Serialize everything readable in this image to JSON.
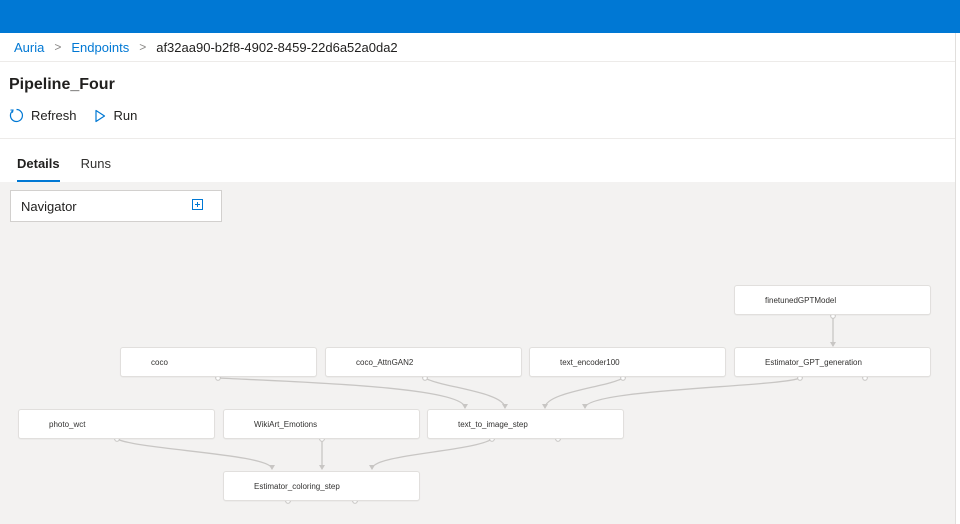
{
  "breadcrumb": {
    "items": [
      "Auria",
      "Endpoints"
    ],
    "current": "af32aa90-b2f8-4902-8459-22d6a52a0da2"
  },
  "page": {
    "title": "Pipeline_Four"
  },
  "toolbar": {
    "refresh_label": "Refresh",
    "run_label": "Run"
  },
  "tabs": [
    "Details",
    "Runs"
  ],
  "active_tab": "Details",
  "navigator": {
    "label": "Navigator",
    "icon": "expand-icon"
  },
  "colors": {
    "accent": "#0078d4",
    "canvas": "#f3f2f1"
  },
  "pipeline": {
    "nodes": {
      "finetunedGPTModel": "finetunedGPTModel",
      "coco": "coco",
      "coco_AttnGAN2": "coco_AttnGAN2",
      "text_encoder100": "text_encoder100",
      "Estimator_GPT_generation": "Estimator_GPT_generation",
      "photo_wct": "photo_wct",
      "WikiArt_Emotions": "WikiArt_Emotions",
      "text_to_image_step": "text_to_image_step",
      "Estimator_coloring_step": "Estimator_coloring_step"
    },
    "edges": [
      [
        "finetunedGPTModel",
        "Estimator_GPT_generation"
      ],
      [
        "coco",
        "text_to_image_step"
      ],
      [
        "coco_AttnGAN2",
        "text_to_image_step"
      ],
      [
        "text_encoder100",
        "text_to_image_step"
      ],
      [
        "Estimator_GPT_generation",
        "text_to_image_step"
      ],
      [
        "photo_wct",
        "Estimator_coloring_step"
      ],
      [
        "WikiArt_Emotions",
        "Estimator_coloring_step"
      ],
      [
        "text_to_image_step",
        "Estimator_coloring_step"
      ]
    ]
  }
}
